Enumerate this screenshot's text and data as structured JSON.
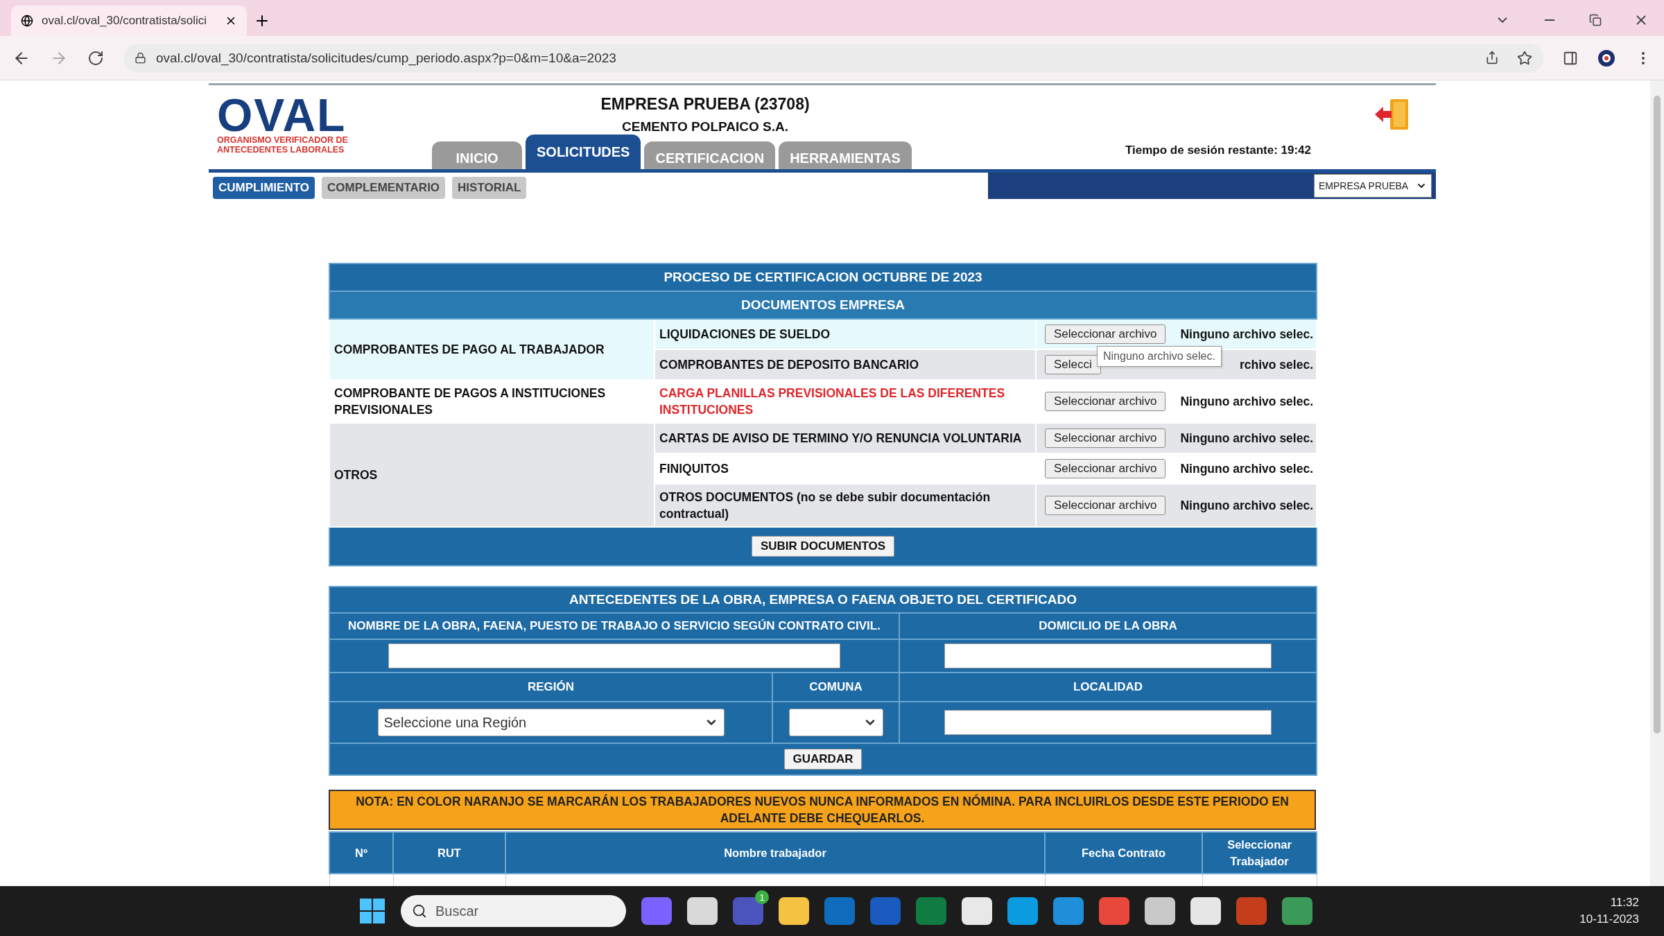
{
  "browser": {
    "tab_title": "oval.cl/oval_30/contratista/solici",
    "url": "oval.cl/oval_30/contratista/solicitudes/cump_periodo.aspx?p=0&m=10&a=2023"
  },
  "header": {
    "logo": "OVAL",
    "logo_subtitle": [
      "ORGANISMO VERIFICADOR DE",
      "ANTECEDENTES LABORALES"
    ],
    "company": "EMPRESA PRUEBA (23708)",
    "client": "CEMENTO POLPAICO S.A.",
    "session": "Tiempo de sesión restante: 19:42"
  },
  "tabs": [
    {
      "label": "INICIO",
      "selected": false
    },
    {
      "label": "SOLICITUDES",
      "selected": true
    },
    {
      "label": "CERTIFICACION",
      "selected": false
    },
    {
      "label": "HERRAMIENTAS",
      "selected": false
    }
  ],
  "subtabs": [
    {
      "label": "CUMPLIMIENTO",
      "selected": true
    },
    {
      "label": "COMPLEMENTARIO",
      "selected": false
    },
    {
      "label": "HISTORIAL",
      "selected": false
    }
  ],
  "company_select": "EMPRESA PRUEBA",
  "documents": {
    "title": "PROCESO DE CERTIFICACION OCTUBRE DE 2023",
    "subtitle": "DOCUMENTOS EMPRESA",
    "tooltip": "Ninguno archivo selec.",
    "groups": [
      {
        "label": "COMPROBANTES DE PAGO AL TRABAJADOR",
        "rows": [
          {
            "label": "LIQUIDACIONES DE SUELDO",
            "alert": false,
            "button": "Seleccionar archivo",
            "status": "Ninguno archivo selec."
          },
          {
            "label": "COMPROBANTES DE DEPOSITO BANCARIO",
            "alert": false,
            "button": "Selecci",
            "status": "rchivo selec."
          }
        ]
      },
      {
        "label": "COMPROBANTE DE PAGOS A INSTITUCIONES PREVISIONALES",
        "rows": [
          {
            "label": "CARGA PLANILLAS PREVISIONALES DE LAS DIFERENTES INSTITUCIONES",
            "alert": true,
            "button": "Seleccionar archivo",
            "status": "Ninguno archivo selec."
          }
        ]
      },
      {
        "label": "OTROS",
        "rows": [
          {
            "label": "CARTAS DE AVISO DE TERMINO Y/O RENUNCIA VOLUNTARIA",
            "alert": false,
            "button": "Seleccionar archivo",
            "status": "Ninguno archivo selec."
          },
          {
            "label": "FINIQUITOS",
            "alert": false,
            "button": "Seleccionar archivo",
            "status": "Ninguno archivo selec."
          },
          {
            "label": "OTROS DOCUMENTOS (no se debe subir documentación contractual)",
            "alert": false,
            "button": "Seleccionar archivo",
            "status": "Ninguno archivo selec."
          }
        ]
      }
    ],
    "submit": "SUBIR DOCUMENTOS"
  },
  "site": {
    "title": "ANTECEDENTES DE LA OBRA, EMPRESA O FAENA OBJETO DEL CERTIFICADO",
    "name_label": "NOMBRE DE LA OBRA, FAENA, PUESTO DE TRABAJO O SERVICIO SEGÚN CONTRATO CIVIL.",
    "address_label": "DOMICILIO DE LA OBRA",
    "region_label": "REGIÓN",
    "region_value": "Seleccione una Región",
    "commune_label": "COMUNA",
    "locality_label": "LOCALIDAD",
    "save": "GUARDAR"
  },
  "note": "NOTA: EN COLOR NARANJO SE MARCARÁN LOS TRABAJADORES NUEVOS NUNCA INFORMADOS EN NÓMINA. PARA INCLUIRLOS DESDE ESTE PERIODO EN ADELANTE DEBE CHEQUEARLOS.",
  "workers": {
    "columns": [
      "Nº",
      "RUT",
      "Nombre trabajador",
      "Fecha Contrato",
      "Seleccionar Trabajador"
    ]
  },
  "taskbar": {
    "search": "Buscar",
    "apps": [
      {
        "color": "#7b61ff"
      },
      {
        "color": "#d9d9d9"
      },
      {
        "color": "#4b53bc",
        "badge": "1"
      },
      {
        "color": "#f5c242"
      },
      {
        "color": "#0f6cbd"
      },
      {
        "color": "#185abd"
      },
      {
        "color": "#107c41"
      },
      {
        "color": "#e8e8e8"
      },
      {
        "color": "#0a9be0"
      },
      {
        "color": "#1e8fd8"
      },
      {
        "color": "#e8483b"
      },
      {
        "color": "#c9c9c9"
      },
      {
        "color": "#e6e6e6"
      },
      {
        "color": "#c43e1c"
      },
      {
        "color": "#3b9a57"
      }
    ],
    "time": "11:32",
    "date": "10-11-2023"
  }
}
